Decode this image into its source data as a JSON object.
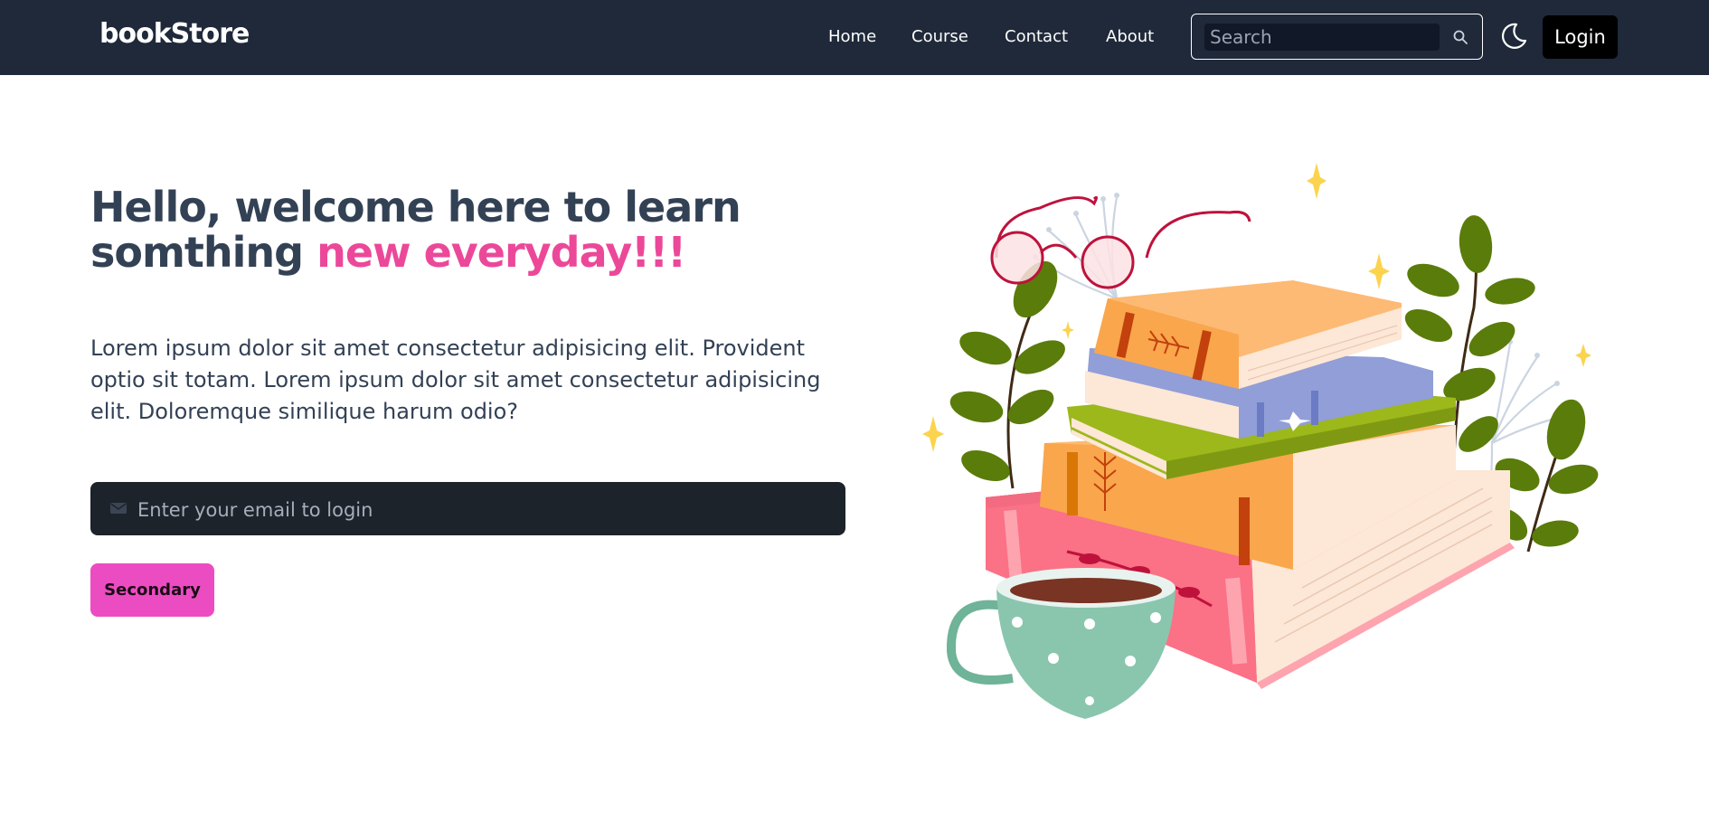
{
  "nav": {
    "brand": "bookStore",
    "links": [
      "Home",
      "Course",
      "Contact",
      "About"
    ],
    "search_placeholder": "Search",
    "login_label": "Login"
  },
  "hero": {
    "title_part1": "Hello, welcome here to learn somthing",
    "title_accent": "new everyday!!!",
    "description": "Lorem ipsum dolor sit amet consectetur adipisicing elit. Provident optio sit totam. Lorem ipsum dolor sit amet consectetur adipisicing elit. Doloremque similique harum odio?",
    "email_placeholder": "Enter your email to login",
    "secondary_label": "Secondary"
  },
  "icons": {
    "search": "search-icon",
    "theme": "moon-icon",
    "mail": "mail-icon"
  },
  "colors": {
    "navbar": "#1f293a",
    "accent": "#ec4899",
    "secondary_button": "#ec4cc1",
    "input_background": "#1d232a"
  }
}
